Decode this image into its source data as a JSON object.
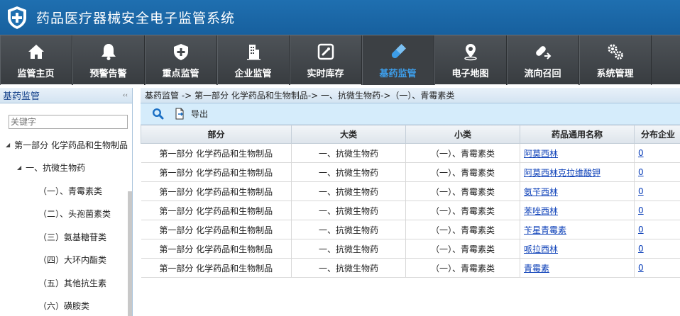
{
  "app": {
    "title": "药品医疗器械安全电子监管系统"
  },
  "nav": [
    {
      "label": "监管主页",
      "icon": "home-icon"
    },
    {
      "label": "预警告警",
      "icon": "bell-icon"
    },
    {
      "label": "重点监管",
      "icon": "shield-plus-icon"
    },
    {
      "label": "企业监管",
      "icon": "building-icon"
    },
    {
      "label": "实时库存",
      "icon": "inventory-icon"
    },
    {
      "label": "基药监管",
      "icon": "capsule-icon",
      "active": true
    },
    {
      "label": "电子地图",
      "icon": "map-pin-icon"
    },
    {
      "label": "流向召回",
      "icon": "recall-icon"
    },
    {
      "label": "系统管理",
      "icon": "gears-icon"
    }
  ],
  "sidebar": {
    "title": "基药监管",
    "collapse": "‹‹",
    "search_placeholder": "关键字",
    "tree": [
      {
        "label": "第一部分 化学药品和生物制品",
        "level": 0,
        "arrow": "◢"
      },
      {
        "label": "一、抗微生物药",
        "level": 1,
        "arrow": "◢"
      },
      {
        "label": "（一）、青霉素类",
        "level": 2
      },
      {
        "label": "（二）、头孢菌素类",
        "level": 2
      },
      {
        "label": "（三）氨基糖苷类",
        "level": 2
      },
      {
        "label": "（四）大环内酯类",
        "level": 2
      },
      {
        "label": "（五）其他抗生素",
        "level": 2
      },
      {
        "label": "（六）磺胺类",
        "level": 2
      }
    ]
  },
  "main": {
    "breadcrumb": "基药监管 -> 第一部分 化学药品和生物制品-> 一、抗微生物药->（一）、青霉素类",
    "toolbar": {
      "export_label": "导出"
    },
    "table": {
      "columns": [
        "部分",
        "大类",
        "小类",
        "药品通用名称",
        "分布企业"
      ],
      "rows": [
        [
          "第一部分 化学药品和生物制品",
          "一、抗微生物药",
          "（一）、青霉素类",
          "阿莫西林",
          "0"
        ],
        [
          "第一部分 化学药品和生物制品",
          "一、抗微生物药",
          "（一）、青霉素类",
          "阿莫西林克拉维酸钾",
          "0"
        ],
        [
          "第一部分 化学药品和生物制品",
          "一、抗微生物药",
          "（一）、青霉素类",
          "氨苄西林",
          "0"
        ],
        [
          "第一部分 化学药品和生物制品",
          "一、抗微生物药",
          "（一）、青霉素类",
          "苯唑西林",
          "0"
        ],
        [
          "第一部分 化学药品和生物制品",
          "一、抗微生物药",
          "（一）、青霉素类",
          "苄星青霉素",
          "0"
        ],
        [
          "第一部分 化学药品和生物制品",
          "一、抗微生物药",
          "（一）、青霉素类",
          "哌拉西林",
          "0"
        ],
        [
          "第一部分 化学药品和生物制品",
          "一、抗微生物药",
          "（一）、青霉素类",
          "青霉素",
          "0"
        ]
      ]
    }
  },
  "colors": {
    "header": "#1f6fb0",
    "nav_bg": "#44484c",
    "active_nav": "#3d9de8",
    "link": "#0b3fb8"
  }
}
